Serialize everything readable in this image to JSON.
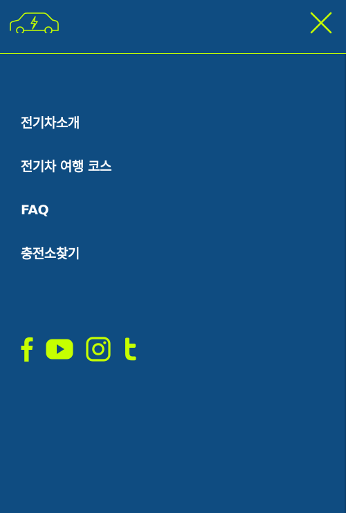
{
  "colors": {
    "background": "#0f4c81",
    "accent": "#c6ff00",
    "text": "#ffffff"
  },
  "header": {
    "logo_icon": "electric-car-icon",
    "close_icon": "close-icon"
  },
  "menu": {
    "items": [
      {
        "label": "전기차소개"
      },
      {
        "label": "전기차 여행 코스"
      },
      {
        "label": "FAQ"
      },
      {
        "label": "충전소찾기"
      }
    ]
  },
  "social": {
    "icons": [
      "facebook-icon",
      "youtube-icon",
      "instagram-icon",
      "twitter-icon"
    ]
  }
}
